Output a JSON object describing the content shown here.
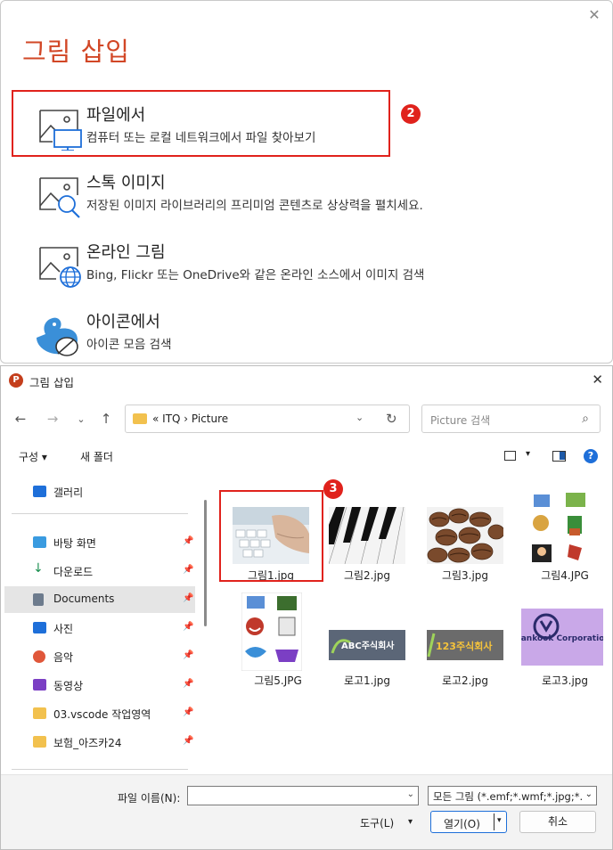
{
  "insert_panel": {
    "title": "그림 삽입",
    "close_glyph": "✕",
    "options": [
      {
        "title": "파일에서",
        "desc": "컴퓨터 또는 로컬 네트워크에서 파일 찾아보기",
        "icon": "picture-monitor-icon"
      },
      {
        "title": "스톡 이미지",
        "desc": "저장된 이미지 라이브러리의 프리미엄 콘텐츠로 상상력을 펼치세요.",
        "icon": "picture-search-icon"
      },
      {
        "title": "온라인 그림",
        "desc": "Bing, Flickr 또는 OneDrive와 같은 온라인 소스에서 이미지 검색",
        "icon": "picture-globe-icon"
      },
      {
        "title": "아이콘에서",
        "desc": "아이콘 모음 검색",
        "icon": "bird-leaf-icon"
      }
    ],
    "step_badge": "2"
  },
  "dialog": {
    "title": "그림 삽입",
    "app_icon": "P",
    "close_glyph": "✕",
    "nav": {
      "back": "←",
      "forward": "→",
      "recent": "⌄",
      "up": "↑"
    },
    "address": {
      "path": "«  ITQ  ›  Picture",
      "dropdown": "⌄",
      "refresh": "↻"
    },
    "search": {
      "placeholder": "Picture 검색",
      "icon": "⌕"
    },
    "toolbar": {
      "organize": "구성 ▾",
      "new_folder": "새 폴더",
      "view_dd": "▾",
      "help": "?"
    },
    "sidebar": {
      "items": [
        {
          "label": "갤러리",
          "icon": "gallery-icon",
          "color": "#1e6fd9",
          "pinned": false
        },
        {
          "label": "바탕 화면",
          "icon": "desktop-icon",
          "color": "#3a9be0",
          "pinned": true
        },
        {
          "label": "다운로드",
          "icon": "download-icon",
          "color": "#1a8f4f",
          "pinned": true
        },
        {
          "label": "Documents",
          "icon": "documents-icon",
          "color": "#6d7b8d",
          "pinned": true,
          "selected": true
        },
        {
          "label": "사진",
          "icon": "pictures-icon",
          "color": "#1e6fd9",
          "pinned": true
        },
        {
          "label": "음악",
          "icon": "music-icon",
          "color": "#e0573a",
          "pinned": true
        },
        {
          "label": "동영상",
          "icon": "video-icon",
          "color": "#7b3fc4",
          "pinned": true
        },
        {
          "label": "03.vscode 작업영역",
          "icon": "folder-icon",
          "color": "#f2c14e",
          "pinned": true
        },
        {
          "label": "보험_아즈카24",
          "icon": "folder-icon",
          "color": "#f2c14e",
          "pinned": true
        }
      ],
      "pin_glyph": "📌"
    },
    "files": [
      {
        "name": "그림1.jpg"
      },
      {
        "name": "그림2.jpg"
      },
      {
        "name": "그림3.jpg"
      },
      {
        "name": "그림4.JPG"
      },
      {
        "name": "그림5.JPG"
      },
      {
        "name": "로고1.jpg",
        "logo_text": "ABC주식회사"
      },
      {
        "name": "로고2.jpg",
        "logo_text": "123주식회사"
      },
      {
        "name": "로고3.jpg",
        "logo_text": "Hankook Corporation"
      }
    ],
    "step_badge": "3",
    "bottom": {
      "filename_label": "파일 이름(N):",
      "filename_value": "",
      "filetype": "모든 그림 (*.emf;*.wmf;*.jpg;*.",
      "tools": "도구(L)",
      "dd": "⌄",
      "open": "열기(O)",
      "open_dd": "▾",
      "cancel": "취소"
    }
  }
}
